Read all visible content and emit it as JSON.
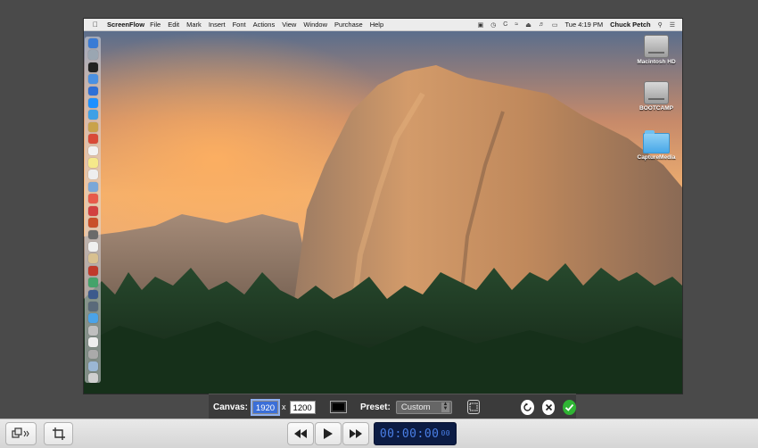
{
  "menubar": {
    "app_name": "ScreenFlow",
    "items": [
      "File",
      "Edit",
      "Mark",
      "Insert",
      "Font",
      "Actions",
      "View",
      "Window",
      "Purchase",
      "Help"
    ],
    "clock": "Tue 4:19 PM",
    "user": "Chuck Petch"
  },
  "desktop": {
    "icons": [
      {
        "label": "Macintosh HD",
        "icon": "hard-drive-icon"
      },
      {
        "label": "BOOTCAMP",
        "icon": "hard-drive-icon"
      },
      {
        "label": "CaptureMedia",
        "icon": "folder-icon"
      }
    ]
  },
  "dock": {
    "item_colors": [
      "#3a7bd5",
      "#9aa6b2",
      "#222",
      "#4a90e2",
      "#2f6fd6",
      "#1e90ff",
      "#3ea0e6",
      "#c9a24a",
      "#d94a38",
      "#f2f2f2",
      "#f5e98a",
      "#eeeeee",
      "#7aa7d8",
      "#e85a4a",
      "#d24040",
      "#c94f2a",
      "#6a6a6a",
      "#efefef",
      "#d8c090",
      "#c0392b",
      "#44a36a",
      "#3c5a8c",
      "#5a6a7a",
      "#4aa3e8",
      "#bfbfbf",
      "#eeeeee",
      "#aaaaaa",
      "#9bb7d4",
      "#cfcfcf"
    ]
  },
  "canvas_toolbar": {
    "canvas_label": "Canvas:",
    "width": "1920",
    "times": "x",
    "height": "1200",
    "preset_label": "Preset:",
    "preset_value": "Custom"
  },
  "playback": {
    "timecode": "00:00:00",
    "frames": "00"
  },
  "colors": {
    "accent": "#3b6fd8",
    "confirm": "#2fb534",
    "timecode_bg": "#0c1c44",
    "timecode_fg": "#4a7fe6"
  }
}
